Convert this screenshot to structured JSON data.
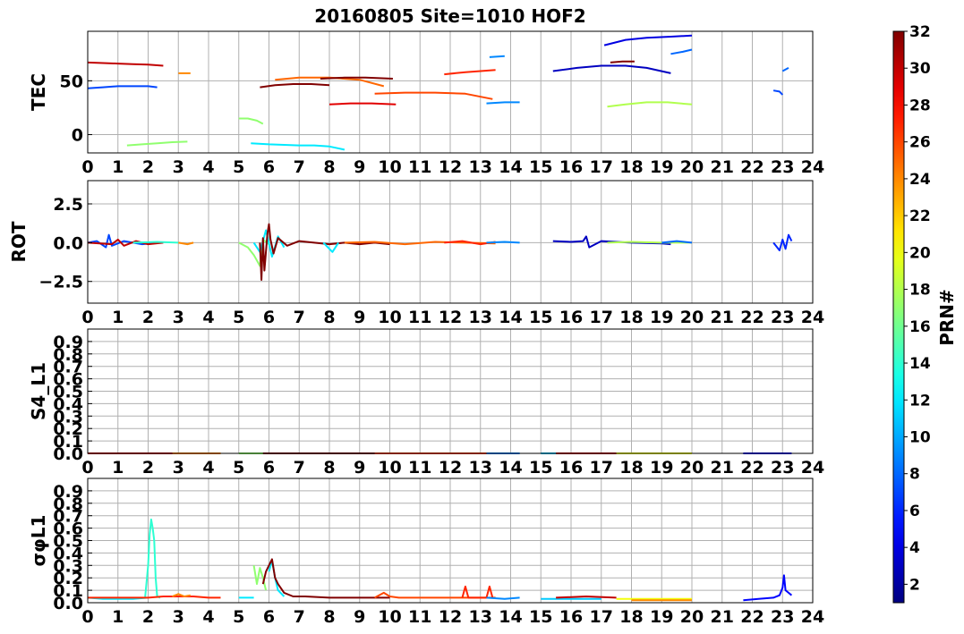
{
  "title": "20160805 Site=1010 HOF2",
  "colorbar": {
    "label": "PRN#",
    "range": [
      1,
      32
    ],
    "ticks": [
      "2",
      "4",
      "6",
      "8",
      "10",
      "12",
      "14",
      "16",
      "18",
      "20",
      "22",
      "24",
      "26",
      "28",
      "30",
      "32"
    ]
  },
  "chart_data": [
    {
      "type": "line",
      "ylabel": "TEC",
      "xlim": [
        0,
        24
      ],
      "ylim": [
        -17,
        96
      ],
      "yticks": [
        0,
        50
      ],
      "ytick_labels": [
        "0",
        "50"
      ],
      "xticks": [
        "0",
        "1",
        "2",
        "3",
        "4",
        "5",
        "6",
        "7",
        "8",
        "9",
        "10",
        "11",
        "12",
        "13",
        "14",
        "15",
        "16",
        "17",
        "18",
        "19",
        "20",
        "21",
        "22",
        "23",
        "24"
      ],
      "grid": true,
      "series": [
        {
          "prn": 30,
          "x": [
            0.0,
            0.5,
            1.0,
            1.5,
            2.0,
            2.5
          ],
          "y": [
            67,
            66.5,
            66,
            65.5,
            65,
            64
          ]
        },
        {
          "prn": 7,
          "x": [
            0.0,
            0.5,
            1.0,
            1.5,
            2.0,
            2.3
          ],
          "y": [
            43,
            44,
            45,
            45,
            45,
            44
          ]
        },
        {
          "prn": 24,
          "x": [
            3.0,
            3.4
          ],
          "y": [
            57,
            57
          ]
        },
        {
          "prn": 17,
          "x": [
            1.3,
            1.8,
            2.3,
            2.8,
            3.3
          ],
          "y": [
            -10,
            -9,
            -8,
            -7,
            -6.5
          ]
        },
        {
          "prn": 17,
          "x": [
            5.0,
            5.3,
            5.6,
            5.8
          ],
          "y": [
            15,
            15,
            13,
            10
          ]
        },
        {
          "prn": 12,
          "x": [
            5.4,
            6.0,
            6.5,
            7.0,
            7.5,
            8.0,
            8.5
          ],
          "y": [
            -8,
            -9,
            -9.5,
            -10,
            -10,
            -11,
            -14
          ]
        },
        {
          "prn": 32,
          "x": [
            5.7,
            6.2,
            6.8,
            7.4,
            8.0
          ],
          "y": [
            44,
            46,
            47,
            47,
            46
          ]
        },
        {
          "prn": 25,
          "x": [
            6.2,
            7.0,
            8.0,
            9.0,
            9.8
          ],
          "y": [
            51,
            53,
            53,
            51,
            45
          ]
        },
        {
          "prn": 32,
          "x": [
            7.7,
            8.5,
            9.2,
            10.1
          ],
          "y": [
            52,
            53,
            53,
            52
          ]
        },
        {
          "prn": 29,
          "x": [
            8.0,
            8.7,
            9.4,
            10.2
          ],
          "y": [
            28,
            29,
            29,
            28
          ]
        },
        {
          "prn": 26,
          "x": [
            9.5,
            10.5,
            11.5,
            12.5,
            13.4
          ],
          "y": [
            38,
            39,
            39,
            38,
            33
          ]
        },
        {
          "prn": 27,
          "x": [
            11.8,
            12.5,
            13.0,
            13.5
          ],
          "y": [
            56,
            58,
            59,
            60
          ]
        },
        {
          "prn": 9,
          "x": [
            13.3,
            13.8
          ],
          "y": [
            72,
            73
          ]
        },
        {
          "prn": 9,
          "x": [
            13.2,
            13.8,
            14.3
          ],
          "y": [
            29,
            30,
            30
          ]
        },
        {
          "prn": 3,
          "x": [
            15.4,
            16.2,
            17.0,
            17.8,
            18.5,
            19.3
          ],
          "y": [
            59,
            62,
            64,
            64,
            62,
            57
          ]
        },
        {
          "prn": 32,
          "x": [
            17.3,
            17.7,
            18.1
          ],
          "y": [
            67,
            68,
            68
          ]
        },
        {
          "prn": 4,
          "x": [
            17.1,
            17.8,
            18.5,
            19.3,
            20.0
          ],
          "y": [
            83,
            88,
            90,
            91,
            92
          ]
        },
        {
          "prn": 8,
          "x": [
            19.3,
            19.7,
            20.0
          ],
          "y": [
            75,
            77,
            79
          ]
        },
        {
          "prn": 18,
          "x": [
            17.2,
            17.8,
            18.5,
            19.2,
            20.0
          ],
          "y": [
            26,
            28,
            30,
            30,
            28
          ]
        },
        {
          "prn": 7,
          "x": [
            22.7,
            22.9,
            23.0
          ],
          "y": [
            41,
            40,
            37
          ]
        },
        {
          "prn": 8,
          "x": [
            23.0,
            23.2
          ],
          "y": [
            59,
            62
          ]
        }
      ]
    },
    {
      "type": "line",
      "ylabel": "ROT",
      "xlim": [
        0,
        24
      ],
      "ylim": [
        -3.9,
        4.0
      ],
      "yticks": [
        -2.5,
        0.0,
        2.5
      ],
      "ytick_labels": [
        "−2.5",
        "0.0",
        "2.5"
      ],
      "xticks": [
        "0",
        "1",
        "2",
        "3",
        "4",
        "5",
        "6",
        "7",
        "8",
        "9",
        "10",
        "11",
        "12",
        "13",
        "14",
        "15",
        "16",
        "17",
        "18",
        "19",
        "20",
        "21",
        "22",
        "23",
        "24"
      ],
      "grid": true,
      "series": [
        {
          "prn": 7,
          "x": [
            0.0,
            0.3,
            0.6,
            0.7,
            0.8,
            1.2,
            1.8,
            2.3
          ],
          "y": [
            0,
            0.1,
            -0.3,
            0.5,
            -0.2,
            0.1,
            -0.1,
            0
          ]
        },
        {
          "prn": 30,
          "x": [
            0.0,
            0.8,
            1.0,
            1.2,
            1.6,
            2.0,
            2.5
          ],
          "y": [
            0,
            -0.1,
            0.2,
            -0.2,
            0.1,
            -0.1,
            0
          ]
        },
        {
          "prn": 14,
          "x": [
            1.5,
            2.3,
            3.0
          ],
          "y": [
            0,
            0.05,
            0
          ]
        },
        {
          "prn": 24,
          "x": [
            3.0,
            3.3,
            3.5
          ],
          "y": [
            0,
            -0.1,
            0
          ]
        },
        {
          "prn": 17,
          "x": [
            5.0,
            5.3,
            5.5,
            5.7,
            5.8,
            6.0
          ],
          "y": [
            0,
            -0.3,
            -0.8,
            -1.5,
            0.2,
            -0.1
          ]
        },
        {
          "prn": 12,
          "x": [
            5.5,
            5.7,
            5.9,
            6.1,
            6.3,
            6.5
          ],
          "y": [
            0,
            -0.6,
            0.8,
            -0.9,
            0.4,
            -0.3
          ]
        },
        {
          "prn": 32,
          "x": [
            5.7,
            5.75,
            5.8,
            5.85,
            5.95,
            6.0,
            6.05,
            6.15,
            6.3,
            6.6,
            7.0,
            7.5,
            8.0,
            8.5,
            9.0,
            9.5,
            10.0
          ],
          "y": [
            0,
            -2.4,
            0.3,
            -1.8,
            0.6,
            1.2,
            0.2,
            -0.7,
            0.3,
            -0.2,
            0.1,
            0,
            -0.1,
            0,
            -0.1,
            0,
            -0.1
          ]
        },
        {
          "prn": 12,
          "x": [
            7.8,
            8.0,
            8.1,
            8.3
          ],
          "y": [
            0,
            -0.4,
            -0.6,
            0
          ]
        },
        {
          "prn": 25,
          "x": [
            8.5,
            9.5,
            10.5,
            11.5,
            12.5,
            13.5
          ],
          "y": [
            0,
            0.05,
            -0.1,
            0.05,
            0,
            -0.05
          ]
        },
        {
          "prn": 27,
          "x": [
            11.8,
            12.4,
            13.0,
            13.5
          ],
          "y": [
            0,
            0.1,
            -0.1,
            0.05
          ]
        },
        {
          "prn": 9,
          "x": [
            13.2,
            13.8,
            14.3
          ],
          "y": [
            0,
            0.05,
            0
          ]
        },
        {
          "prn": 3,
          "x": [
            15.4,
            16.0,
            16.4,
            16.5,
            16.6,
            17.0,
            18.0,
            19.0,
            19.3
          ],
          "y": [
            0.1,
            0.05,
            0.1,
            0.4,
            -0.3,
            0.1,
            0,
            -0.05,
            -0.1
          ]
        },
        {
          "prn": 18,
          "x": [
            17.2,
            18.0,
            19.0,
            20.0
          ],
          "y": [
            0,
            0.05,
            0,
            0
          ]
        },
        {
          "prn": 8,
          "x": [
            19.0,
            19.5,
            20.0
          ],
          "y": [
            0,
            0.1,
            0
          ]
        },
        {
          "prn": 6,
          "x": [
            22.7,
            22.9,
            23.0,
            23.1,
            23.2,
            23.3
          ],
          "y": [
            0,
            -0.5,
            0.2,
            -0.4,
            0.5,
            0.1
          ]
        }
      ]
    },
    {
      "type": "line",
      "ylabel": "S4_L1",
      "xlim": [
        0,
        24
      ],
      "ylim": [
        0.0,
        1.0
      ],
      "yticks": [
        0.0,
        0.1,
        0.2,
        0.3,
        0.4,
        0.5,
        0.6,
        0.7,
        0.8,
        0.9
      ],
      "ytick_labels": [
        "0.0",
        "0.1",
        "0.2",
        "0.3",
        "0.4",
        "0.5",
        "0.6",
        "0.7",
        "0.8",
        "0.9"
      ],
      "xticks": [
        "0",
        "1",
        "2",
        "3",
        "4",
        "5",
        "6",
        "7",
        "8",
        "9",
        "10",
        "11",
        "12",
        "13",
        "14",
        "15",
        "16",
        "17",
        "18",
        "19",
        "20",
        "21",
        "22",
        "23",
        "24"
      ],
      "grid": true,
      "series": [
        {
          "prn": 30,
          "x": [
            0.0,
            4.4
          ],
          "y": [
            0.0,
            0.0
          ]
        },
        {
          "prn": 24,
          "x": [
            2.8,
            4.4
          ],
          "y": [
            0.0,
            0.0
          ]
        },
        {
          "prn": 17,
          "x": [
            5.0,
            6.0
          ],
          "y": [
            0.0,
            0.0
          ]
        },
        {
          "prn": 32,
          "x": [
            5.8,
            10.2
          ],
          "y": [
            0.0,
            0.0
          ]
        },
        {
          "prn": 26,
          "x": [
            9.5,
            13.5
          ],
          "y": [
            0.0,
            0.0
          ]
        },
        {
          "prn": 9,
          "x": [
            13.2,
            14.3
          ],
          "y": [
            0.0,
            0.0
          ]
        },
        {
          "prn": 11,
          "x": [
            15.0,
            17.0
          ],
          "y": [
            0.0,
            0.0
          ]
        },
        {
          "prn": 30,
          "x": [
            15.5,
            17.5
          ],
          "y": [
            0.0,
            0.0
          ]
        },
        {
          "prn": 20,
          "x": [
            17.5,
            20.0
          ],
          "y": [
            0.0,
            0.0
          ]
        },
        {
          "prn": 5,
          "x": [
            21.7,
            23.3
          ],
          "y": [
            0.0,
            0.0
          ]
        }
      ]
    },
    {
      "type": "line",
      "ylabel": "σφL1",
      "xlim": [
        0,
        24
      ],
      "ylim": [
        0.0,
        1.0
      ],
      "yticks": [
        0.0,
        0.1,
        0.2,
        0.3,
        0.4,
        0.5,
        0.6,
        0.7,
        0.8,
        0.9
      ],
      "ytick_labels": [
        "0.0",
        "0.1",
        "0.2",
        "0.3",
        "0.4",
        "0.5",
        "0.6",
        "0.7",
        "0.8",
        "0.9"
      ],
      "xticks": [
        "0",
        "1",
        "2",
        "3",
        "4",
        "5",
        "6",
        "7",
        "8",
        "9",
        "10",
        "11",
        "12",
        "13",
        "14",
        "15",
        "16",
        "17",
        "18",
        "19",
        "20",
        "21",
        "22",
        "23",
        "24"
      ],
      "grid": true,
      "series": [
        {
          "prn": 12,
          "x": [
            0.0,
            0.5,
            1.0,
            1.5,
            2.0
          ],
          "y": [
            0.04,
            0.03,
            0.03,
            0.03,
            0.04
          ]
        },
        {
          "prn": 14,
          "x": [
            1.9,
            2.0,
            2.05,
            2.1,
            2.15,
            2.2,
            2.25,
            2.3,
            2.4
          ],
          "y": [
            0.04,
            0.3,
            0.55,
            0.67,
            0.6,
            0.5,
            0.2,
            0.05,
            0.04
          ]
        },
        {
          "prn": 27,
          "x": [
            0.0,
            1.0,
            2.0,
            2.5,
            3.0,
            3.5,
            4.0,
            4.4
          ],
          "y": [
            0.04,
            0.04,
            0.04,
            0.05,
            0.05,
            0.05,
            0.04,
            0.04
          ]
        },
        {
          "prn": 24,
          "x": [
            2.8,
            3.0,
            3.2,
            3.4
          ],
          "y": [
            0.05,
            0.07,
            0.05,
            0.06
          ]
        },
        {
          "prn": 12,
          "x": [
            5.0,
            5.2,
            5.5
          ],
          "y": [
            0.04,
            0.04,
            0.04
          ]
        },
        {
          "prn": 17,
          "x": [
            5.5,
            5.6,
            5.7,
            5.8,
            5.9
          ],
          "y": [
            0.3,
            0.15,
            0.28,
            0.2,
            0.1
          ]
        },
        {
          "prn": 12,
          "x": [
            6.0,
            6.1,
            6.2,
            6.3,
            6.5
          ],
          "y": [
            0.25,
            0.34,
            0.2,
            0.1,
            0.05
          ]
        },
        {
          "prn": 32,
          "x": [
            5.8,
            5.9,
            6.0,
            6.1,
            6.2,
            6.3,
            6.5,
            6.8,
            7.2,
            8.0,
            9.0,
            10.0
          ],
          "y": [
            0.15,
            0.25,
            0.3,
            0.35,
            0.2,
            0.15,
            0.08,
            0.05,
            0.05,
            0.04,
            0.04,
            0.04
          ]
        },
        {
          "prn": 26,
          "x": [
            9.5,
            9.8,
            10.0,
            10.3,
            11.0,
            12.0,
            12.5,
            13.0,
            13.5
          ],
          "y": [
            0.04,
            0.08,
            0.05,
            0.04,
            0.04,
            0.04,
            0.04,
            0.04,
            0.04
          ]
        },
        {
          "prn": 27,
          "x": [
            12.4,
            12.5,
            12.6,
            13.2,
            13.3,
            13.4
          ],
          "y": [
            0.04,
            0.13,
            0.04,
            0.04,
            0.13,
            0.04
          ]
        },
        {
          "prn": 9,
          "x": [
            13.2,
            13.8,
            14.3
          ],
          "y": [
            0.04,
            0.03,
            0.04
          ]
        },
        {
          "prn": 11,
          "x": [
            15.0,
            16.0,
            17.0
          ],
          "y": [
            0.03,
            0.03,
            0.03
          ]
        },
        {
          "prn": 30,
          "x": [
            15.5,
            16.5,
            17.5
          ],
          "y": [
            0.04,
            0.05,
            0.04
          ]
        },
        {
          "prn": 20,
          "x": [
            17.5,
            18.5,
            20.0
          ],
          "y": [
            0.03,
            0.03,
            0.03
          ]
        },
        {
          "prn": 24,
          "x": [
            18.0,
            19.0,
            20.0
          ],
          "y": [
            0.02,
            0.02,
            0.02
          ]
        },
        {
          "prn": 5,
          "x": [
            21.7,
            22.2,
            22.7,
            22.9,
            23.0,
            23.05,
            23.1,
            23.2,
            23.3
          ],
          "y": [
            0.02,
            0.03,
            0.04,
            0.06,
            0.12,
            0.22,
            0.1,
            0.08,
            0.06
          ]
        }
      ]
    }
  ]
}
